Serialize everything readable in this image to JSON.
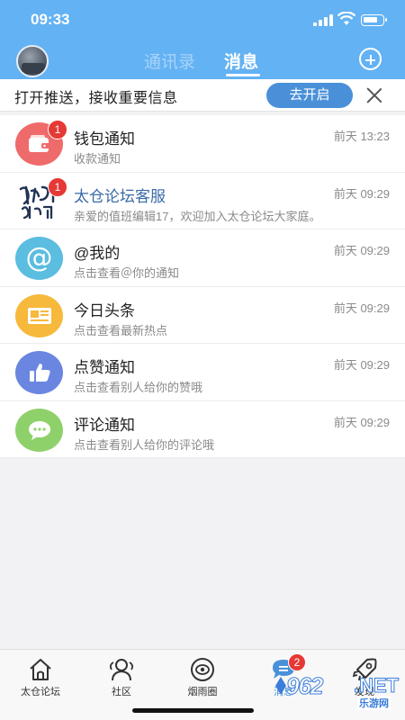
{
  "status_bar": {
    "time": "09:33"
  },
  "header": {
    "tabs": [
      {
        "label": "通讯录",
        "active": false
      },
      {
        "label": "消息",
        "active": true
      }
    ],
    "add_icon": "plus-circle-icon"
  },
  "push_banner": {
    "text": "打开推送，接收重要信息",
    "button_label": "去开启",
    "close_icon": "close-icon"
  },
  "messages": [
    {
      "title": "钱包通知",
      "subtitle": "收款通知",
      "time": "前天 13:23",
      "badge": "1",
      "icon": "wallet-icon",
      "color": "#ef6b6b"
    },
    {
      "title": "太仓论坛客服",
      "subtitle": "亲爱的值班编辑17，欢迎加入太仓论坛大家庭。",
      "time": "前天 09:29",
      "badge": "1",
      "icon": "calligraphy-avatar",
      "color": "#ffffff"
    },
    {
      "title": "@我的",
      "subtitle": "点击查看＠你的通知",
      "time": "前天 09:29",
      "badge": "",
      "icon": "at-icon",
      "color": "#5bbde0"
    },
    {
      "title": "今日头条",
      "subtitle": "点击查看最新热点",
      "time": "前天 09:29",
      "badge": "",
      "icon": "newspaper-icon",
      "color": "#f6b93b"
    },
    {
      "title": "点赞通知",
      "subtitle": "点击查看别人给你的赞哦",
      "time": "前天 09:29",
      "badge": "",
      "icon": "thumbs-up-icon",
      "color": "#6b86e0"
    },
    {
      "title": "评论通知",
      "subtitle": "点击查看别人给你的评论哦",
      "time": "前天 09:29",
      "badge": "",
      "icon": "comment-icon",
      "color": "#8ed16a"
    }
  ],
  "tabbar": [
    {
      "label": "太仓论坛",
      "icon": "home-icon",
      "active": false,
      "badge": ""
    },
    {
      "label": "社区",
      "icon": "community-icon",
      "active": false,
      "badge": ""
    },
    {
      "label": "烟雨圈",
      "icon": "circle-eye-icon",
      "active": false,
      "badge": ""
    },
    {
      "label": "消息",
      "icon": "message-icon",
      "active": true,
      "badge": "2"
    },
    {
      "label": "发现",
      "icon": "rocket-icon",
      "active": false,
      "badge": ""
    }
  ],
  "watermark": {
    "number": "962",
    "net": ".NET",
    "cn": "乐游网"
  },
  "colors": {
    "header": "#63b2f3",
    "accent": "#4a90d9",
    "badge": "#e53935"
  }
}
